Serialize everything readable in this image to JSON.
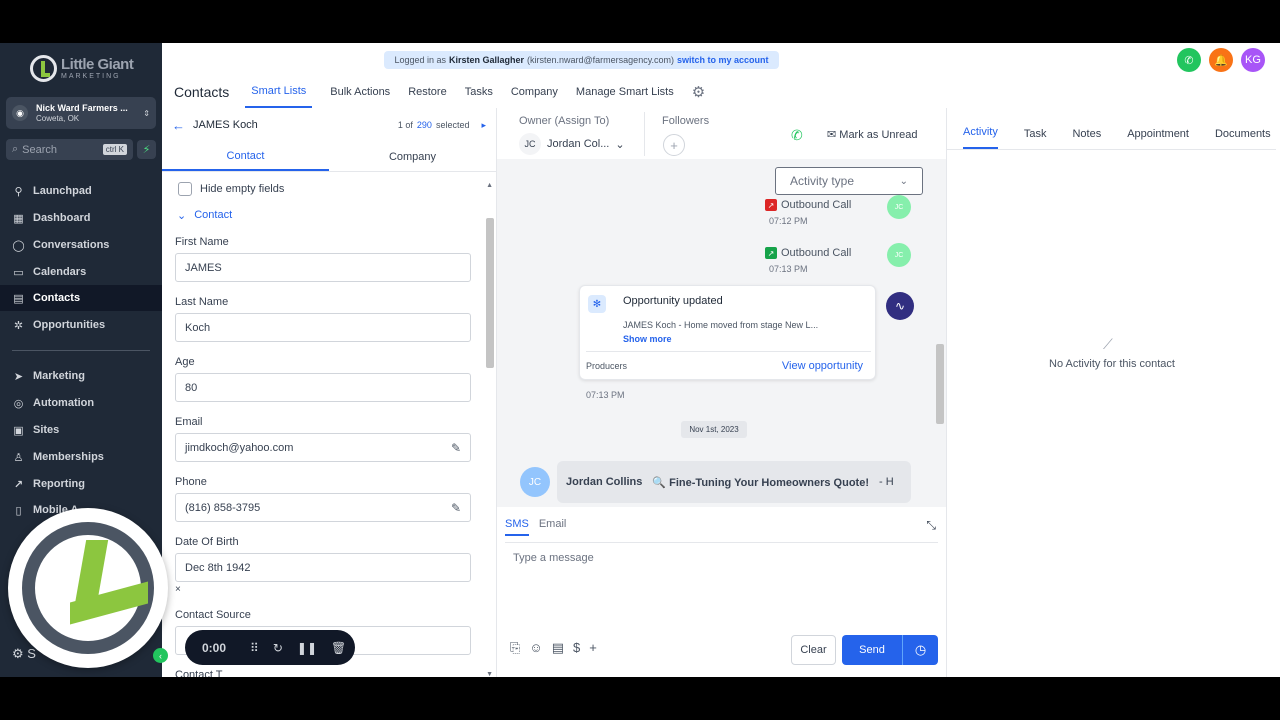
{
  "app": {
    "logo_line1": "Little Giant",
    "logo_line2": "MARKETING",
    "account_name": "Nick Ward Farmers ...",
    "account_location": "Coweta, OK",
    "search_placeholder": "Search",
    "search_shortcut": "ctrl K"
  },
  "sidebar": {
    "items": [
      {
        "label": "Launchpad",
        "icon": "rocket-icon"
      },
      {
        "label": "Dashboard",
        "icon": "grid-icon"
      },
      {
        "label": "Conversations",
        "icon": "chat-icon"
      },
      {
        "label": "Calendars",
        "icon": "calendar-icon"
      },
      {
        "label": "Contacts",
        "icon": "contacts-icon",
        "active": true
      },
      {
        "label": "Opportunities",
        "icon": "opportunities-icon"
      },
      {
        "label": "Marketing",
        "icon": "send-icon"
      },
      {
        "label": "Automation",
        "icon": "automation-icon"
      },
      {
        "label": "Sites",
        "icon": "sites-icon"
      },
      {
        "label": "Memberships",
        "icon": "memberships-icon"
      },
      {
        "label": "Reporting",
        "icon": "chart-icon"
      },
      {
        "label": "Mobile A",
        "icon": "mobile-icon"
      }
    ],
    "settings_label": "S"
  },
  "banner": {
    "prefix": "Logged in as",
    "user": "Kirsten Gallagher",
    "email": "(kirsten.nward@farmersagency.com)",
    "link": "switch to my account"
  },
  "header": {
    "avatar_initials": "KG"
  },
  "topnav": {
    "title": "Contacts",
    "items": [
      "Smart Lists",
      "Bulk Actions",
      "Restore",
      "Tasks",
      "Company",
      "Manage Smart Lists"
    ]
  },
  "contact_panel": {
    "name": "JAMES Koch",
    "page_prefix": "1 of",
    "page_count": "290",
    "page_suffix": "selected",
    "tabs": [
      "Contact",
      "Company"
    ],
    "hide_empty_label": "Hide empty fields",
    "section_label": "Contact",
    "fields": {
      "first_name_label": "First Name",
      "first_name": "JAMES",
      "last_name_label": "Last Name",
      "last_name": "Koch",
      "age_label": "Age",
      "age": "80",
      "email_label": "Email",
      "email": "jimdkoch@yahoo.com",
      "phone_label": "Phone",
      "phone": "(816) 858-3795",
      "dob_label": "Date Of Birth",
      "dob": "Dec 8th 1942",
      "source_label": "Contact Source",
      "next_label": "Contact T"
    }
  },
  "conversation": {
    "owner_label": "Owner (Assign To)",
    "owner_initials": "JC",
    "owner_name": "Jordan Col...",
    "followers_label": "Followers",
    "mark_unread": "Mark as Unread",
    "activity_type_placeholder": "Activity type",
    "calls": [
      {
        "label": "Outbound Call",
        "time": "07:12 PM",
        "initials": "JC"
      },
      {
        "label": "Outbound Call",
        "time": "07:13 PM",
        "initials": "JC"
      }
    ],
    "opportunity": {
      "title": "Opportunity updated",
      "detail": "JAMES Koch - Home moved from stage New L...",
      "show_more": "Show more",
      "pipeline": "Producers",
      "view": "View opportunity",
      "time": "07:13 PM"
    },
    "date_divider": "Nov 1st, 2023",
    "email_msg": {
      "initials": "JC",
      "sender": "Jordan Collins",
      "subject": "🔍 Fine-Tuning Your Homeowners Quote!",
      "snippet": "-  H"
    },
    "composer": {
      "tabs": [
        "SMS",
        "Email"
      ],
      "placeholder": "Type a message",
      "clear": "Clear",
      "send": "Send"
    }
  },
  "activity_panel": {
    "tabs": [
      "Activity",
      "Task",
      "Notes",
      "Appointment",
      "Documents"
    ],
    "empty": "No Activity for this contact"
  },
  "recorder": {
    "time": "0:00"
  },
  "colors": {
    "accent": "#2563eb",
    "sidebar": "#1f2937",
    "brand_green": "#8cc63f"
  }
}
